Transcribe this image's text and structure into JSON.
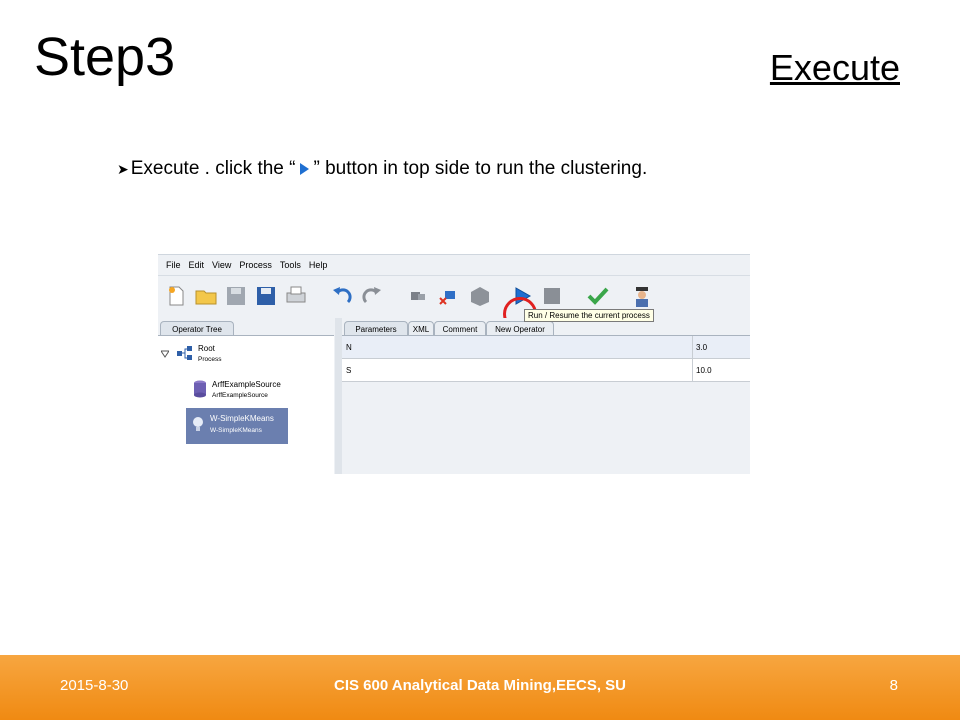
{
  "slide": {
    "title": "Step3",
    "subtitle": "Execute",
    "bullet_before": "Execute . click the “",
    "bullet_after": "” button in top side to run the clustering."
  },
  "app": {
    "menu": [
      "File",
      "Edit",
      "View",
      "Process",
      "Tools",
      "Help"
    ],
    "toolbar_icons": [
      "new-icon",
      "open-folder-icon",
      "save-icon",
      "save-as-icon",
      "print-icon",
      "undo-icon",
      "redo-icon",
      "operator-icon",
      "delete-operator-icon",
      "box-icon",
      "run-icon",
      "stop-icon",
      "validate-check-icon",
      "wizard-icon"
    ],
    "tooltip": "Run / Resume the current process",
    "left_tab": "Operator Tree",
    "tree": {
      "root_label": "Root",
      "root_sub": "Process",
      "node1_label": "ArffExampleSource",
      "node1_sub": "ArffExampleSource",
      "node2_label": "W-SimpleKMeans",
      "node2_sub": "W-SimpleKMeans"
    },
    "right_tabs": [
      "Parameters",
      "XML",
      "Comment",
      "New Operator"
    ],
    "params": [
      {
        "name": "N",
        "value": "3.0"
      },
      {
        "name": "S",
        "value": "10.0"
      }
    ]
  },
  "footer": {
    "date": "2015-8-30",
    "center": "CIS 600 Analytical Data Mining,EECS, SU",
    "page": "8"
  },
  "colors": {
    "footer_orange": "#f08a12",
    "highlight_red": "#e02020",
    "selected_node": "#6b7faf"
  }
}
